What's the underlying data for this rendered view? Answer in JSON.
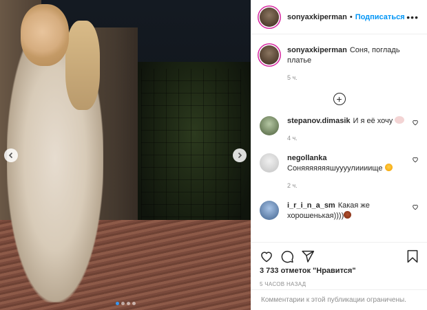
{
  "post": {
    "username": "sonyaxkiperman",
    "follow_label": "Подписаться",
    "separator": "•",
    "more_label": "•••",
    "caption_text": "Соня, погладь платье",
    "caption_time": "5 ч."
  },
  "carousel": {
    "total": 4,
    "active_index": 0
  },
  "comments": [
    {
      "username": "stepanov.dimasik",
      "text": "И я её хочу",
      "time": "4 ч."
    },
    {
      "username": "negollanka",
      "text": "Соняяяяяяяшуууулиииище",
      "time": "2 ч."
    },
    {
      "username": "i_r_i_n_a_sm",
      "text": "Какая же хорошенькая))))"
    }
  ],
  "actions": {
    "likes": "3 733 отметок \"Нравится\"",
    "time": "5 ЧАСОВ НАЗАД",
    "comments_limited": "Комментарии к этой публикации ограничены."
  },
  "colors": {
    "link_blue": "#0095f6",
    "muted": "#8e8e8e",
    "dot_active": "#3897f0"
  },
  "icons": [
    "chevron-left-icon",
    "chevron-right-icon",
    "plus-circle-icon",
    "heart-icon",
    "comment-icon",
    "share-icon",
    "bookmark-icon"
  ]
}
